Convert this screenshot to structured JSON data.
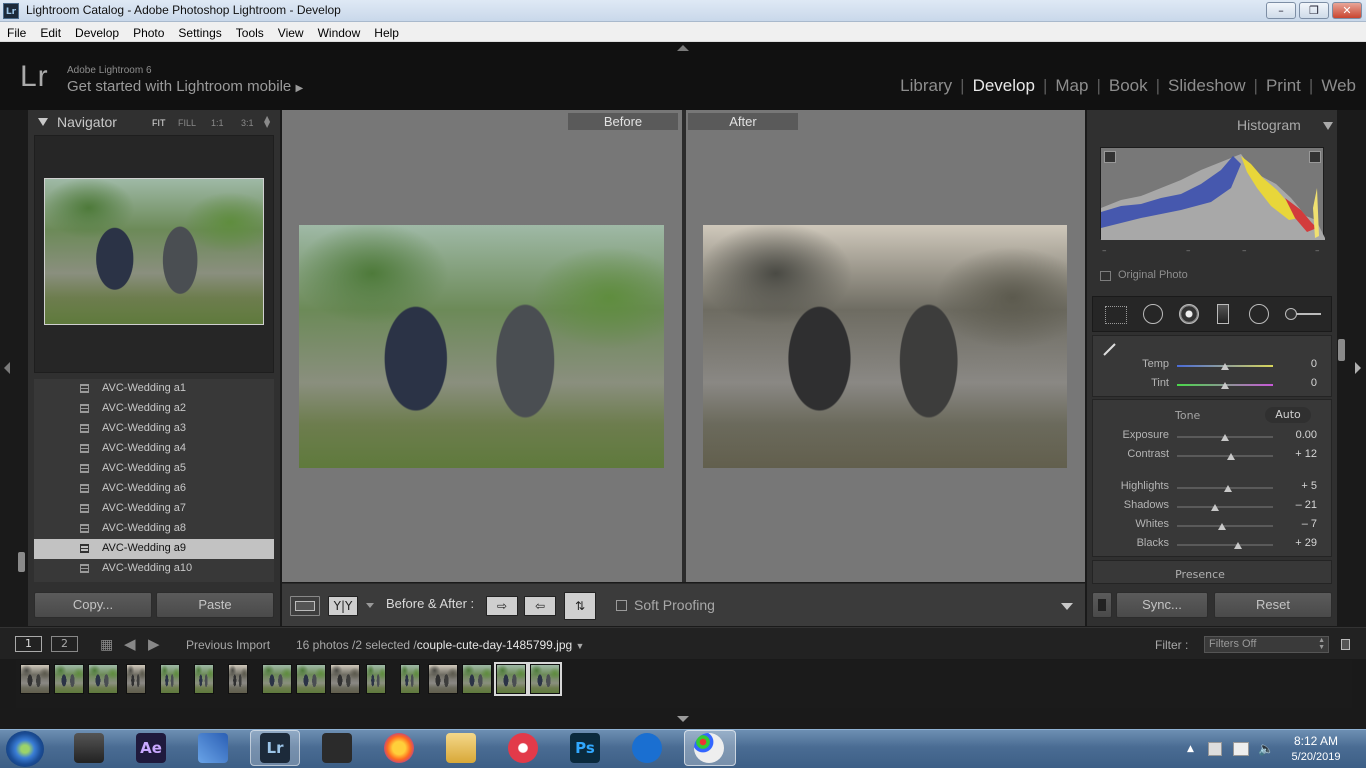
{
  "window": {
    "title": "Lightroom Catalog - Adobe Photoshop Lightroom - Develop",
    "app_icon": "Lr",
    "minimize": "–",
    "maximize": "❐",
    "close": "✕"
  },
  "menu": [
    "File",
    "Edit",
    "Develop",
    "Photo",
    "Settings",
    "Tools",
    "View",
    "Window",
    "Help"
  ],
  "identity": {
    "logo": "Lr",
    "product": "Adobe Lightroom 6",
    "tagline": "Get started with Lightroom mobile"
  },
  "modules": {
    "items": [
      "Library",
      "Develop",
      "Map",
      "Book",
      "Slideshow",
      "Print",
      "Web"
    ],
    "active": "Develop"
  },
  "navigator": {
    "title": "Navigator",
    "options": [
      "FIT",
      "FILL",
      "1:1",
      "3:1"
    ]
  },
  "files": {
    "items": [
      "AVC-Wedding a1",
      "AVC-Wedding a2",
      "AVC-Wedding a3",
      "AVC-Wedding a4",
      "AVC-Wedding a5",
      "AVC-Wedding a6",
      "AVC-Wedding a7",
      "AVC-Wedding a8",
      "AVC-Wedding a9",
      "AVC-Wedding a10"
    ],
    "selected_index": 8
  },
  "left_buttons": {
    "copy": "Copy...",
    "paste": "Paste"
  },
  "view": {
    "before": "Before",
    "after": "After"
  },
  "toolbar": {
    "yy": "Y|Y",
    "before_after_label": "Before & After :",
    "soft_proofing": "Soft Proofing"
  },
  "histogram": {
    "title": "Histogram",
    "original_photo": "Original Photo",
    "ticks": [
      "–",
      "–",
      "–",
      "–"
    ]
  },
  "basic": {
    "temp": {
      "label": "Temp",
      "value": "0",
      "pos": 0.5
    },
    "tint": {
      "label": "Tint",
      "value": "0",
      "pos": 0.5
    },
    "tone_label": "Tone",
    "auto": "Auto",
    "exposure": {
      "label": "Exposure",
      "value": "0.00",
      "pos": 0.5
    },
    "contrast": {
      "label": "Contrast",
      "value": "+ 12",
      "pos": 0.56
    },
    "highlights": {
      "label": "Highlights",
      "value": "+ 5",
      "pos": 0.53
    },
    "shadows": {
      "label": "Shadows",
      "value": "– 21",
      "pos": 0.4
    },
    "whites": {
      "label": "Whites",
      "value": "– 7",
      "pos": 0.47
    },
    "blacks": {
      "label": "Blacks",
      "value": "+ 29",
      "pos": 0.64
    },
    "presence": "Presence"
  },
  "right_buttons": {
    "sync": "Sync...",
    "reset": "Reset"
  },
  "statusbar": {
    "page1": "1",
    "page2": "2",
    "source": "Previous Import",
    "count": "16 photos /2 selected /",
    "filename": "couple-cute-day-1485799.jpg",
    "filter_label": "Filter :",
    "filter_value": "Filters Off"
  },
  "tray": {
    "time": "8:12 AM",
    "date": "5/20/2019"
  },
  "colors": {
    "accent": "#e8e8e8",
    "panel": "#303030",
    "taskbar": "#4a6c93"
  }
}
